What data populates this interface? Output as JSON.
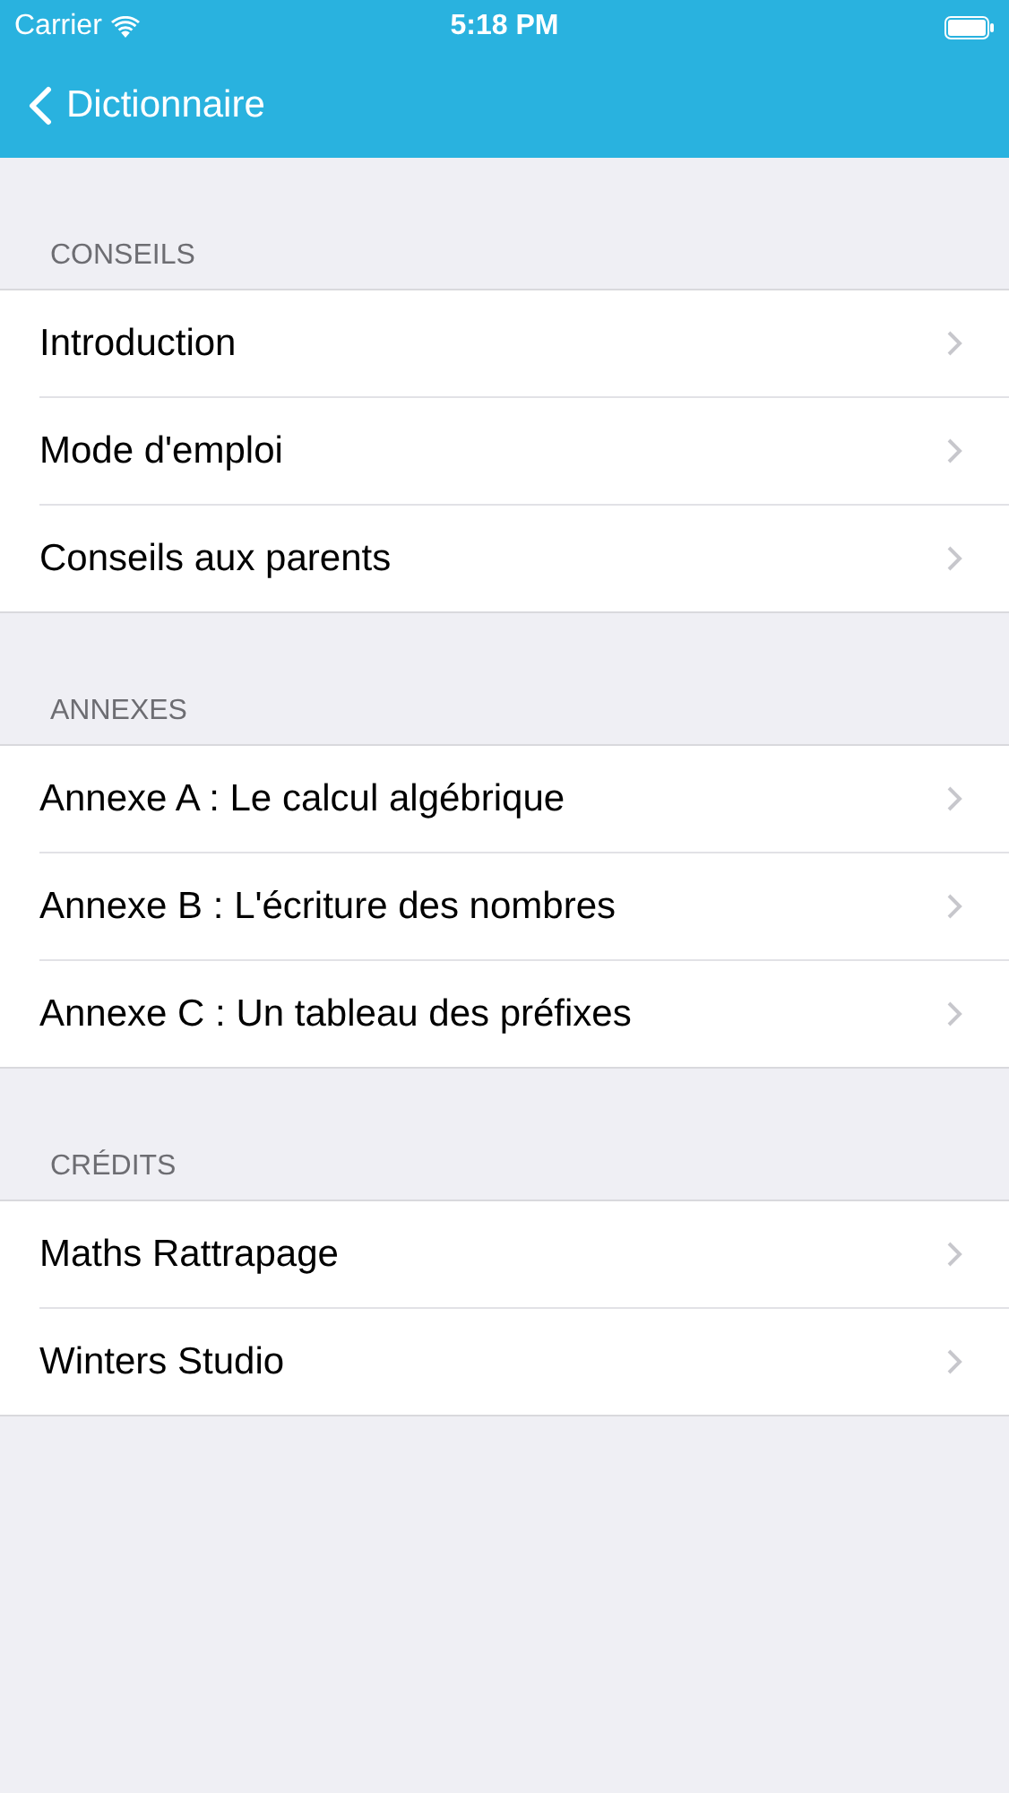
{
  "status_bar": {
    "carrier": "Carrier",
    "time": "5:18 PM"
  },
  "nav_bar": {
    "back_label": "Dictionnaire"
  },
  "sections": [
    {
      "header": "CONSEILS",
      "items": [
        {
          "label": "Introduction"
        },
        {
          "label": "Mode d'emploi"
        },
        {
          "label": "Conseils aux parents"
        }
      ]
    },
    {
      "header": "ANNEXES",
      "items": [
        {
          "label": "Annexe A : Le calcul algébrique"
        },
        {
          "label": "Annexe B : L'écriture des nombres"
        },
        {
          "label": "Annexe C : Un tableau des préfixes"
        }
      ]
    },
    {
      "header": "CRÉDITS",
      "items": [
        {
          "label": "Maths Rattrapage"
        },
        {
          "label": "Winters Studio"
        }
      ]
    }
  ]
}
